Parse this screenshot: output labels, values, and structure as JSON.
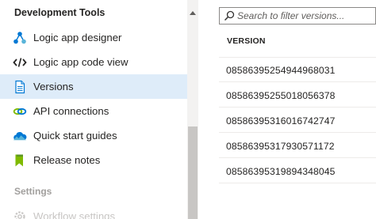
{
  "nav": {
    "section_development": "Development Tools",
    "section_settings": "Settings",
    "items": [
      {
        "label": "Logic app designer",
        "icon": "network-icon"
      },
      {
        "label": "Logic app code view",
        "icon": "code-icon"
      },
      {
        "label": "Versions",
        "icon": "document-icon",
        "selected": true
      },
      {
        "label": "API connections",
        "icon": "link-icon"
      },
      {
        "label": "Quick start guides",
        "icon": "cloud-icon"
      },
      {
        "label": "Release notes",
        "icon": "bookmark-icon"
      },
      {
        "label": "Workflow settings",
        "icon": "gear-icon",
        "disabled": true
      }
    ]
  },
  "versions": {
    "search_placeholder": "Search to filter versions...",
    "column_header": "VERSION",
    "rows": [
      "08586395254944968031",
      "08586395255018056378",
      "08586395316016742747",
      "08586395317930571172",
      "08586395319894348045"
    ]
  },
  "colors": {
    "selected_bg": "#deecf9",
    "accent_blue": "#0078d4",
    "text": "#252423",
    "disabled": "#c8c6c4"
  }
}
